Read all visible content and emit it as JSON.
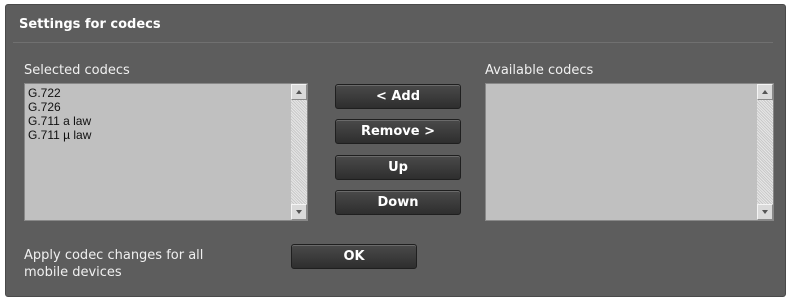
{
  "section": {
    "title": "Settings for codecs"
  },
  "selected": {
    "label": "Selected codecs",
    "items": [
      "G.722",
      "G.726",
      "G.711 a law",
      "G.711 µ law"
    ]
  },
  "available": {
    "label": "Available codecs",
    "items": []
  },
  "buttons": {
    "add": "< Add",
    "remove": "Remove >",
    "up": "Up",
    "down": "Down",
    "ok": "OK"
  },
  "apply": {
    "line1": "Apply codec changes for all",
    "line2": "mobile devices"
  },
  "colors": {
    "panel_bg": "#5d5d5d",
    "button_bg": "#3a3a3a",
    "listbox_bg": "#c0c0c0"
  }
}
